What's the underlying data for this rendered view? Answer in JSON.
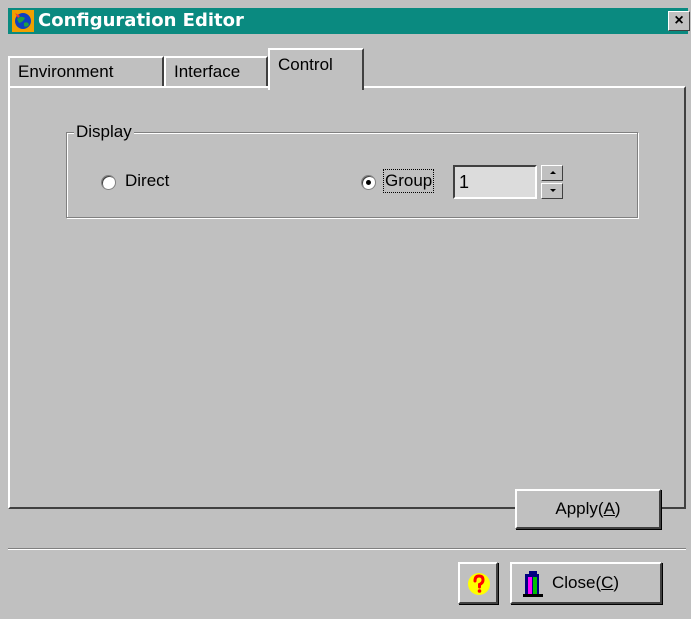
{
  "window": {
    "title": "Configuration Editor",
    "close_label": "×"
  },
  "tabs": [
    {
      "label": "Environment",
      "active": false
    },
    {
      "label": "Interface",
      "active": false
    },
    {
      "label": "Control",
      "active": true
    }
  ],
  "display_group": {
    "label": "Display",
    "options": [
      {
        "label": "Direct",
        "checked": false
      },
      {
        "label": "Group",
        "checked": true
      }
    ],
    "group_value": "1"
  },
  "buttons": {
    "apply_label": "Apply(",
    "apply_mnemonic": "A",
    "apply_suffix": ")",
    "close_label": "Close(",
    "close_mnemonic": "C",
    "close_suffix": ")"
  },
  "icons": {
    "app": "app-globe-icon",
    "help": "question-mark-icon",
    "close": "door-exit-icon"
  },
  "colors": {
    "titlebar": "#0a8a80",
    "face": "#c0c0c0",
    "help_yellow": "#ffff00",
    "help_red": "#ff0000"
  }
}
